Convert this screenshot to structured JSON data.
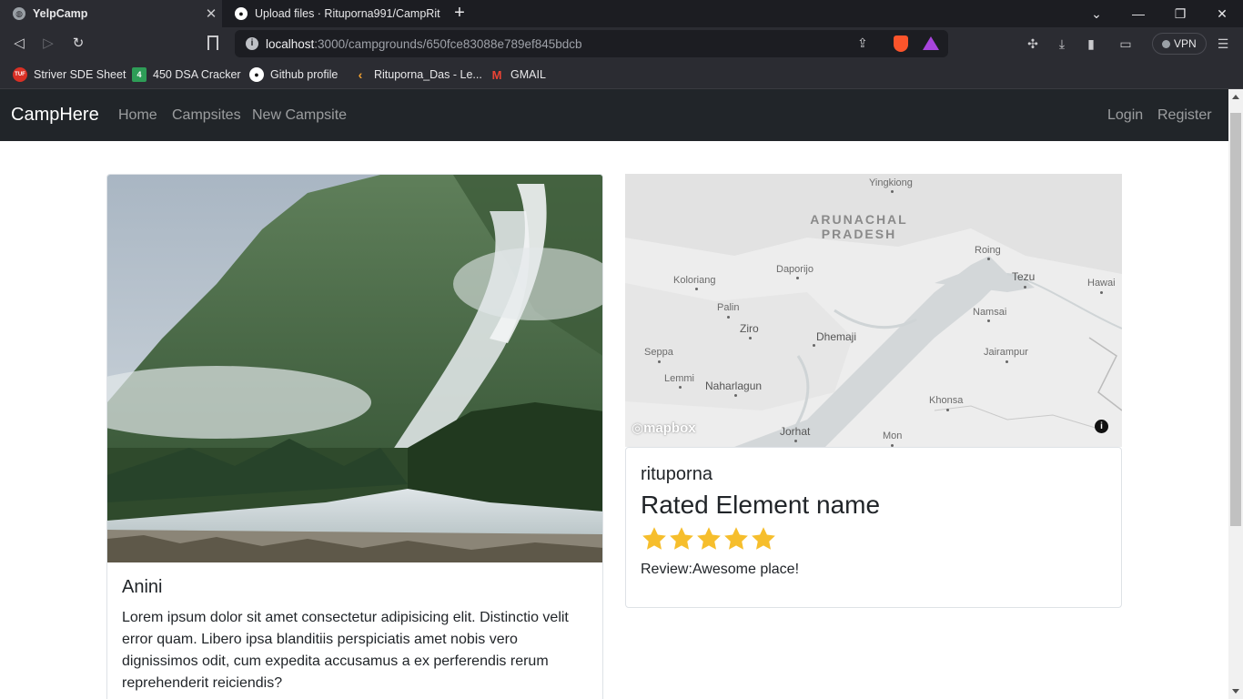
{
  "browser": {
    "tabs": [
      {
        "title": "YelpCamp",
        "active": true
      },
      {
        "title": "Upload files · Rituporna991/CampRitu",
        "active": false
      }
    ],
    "url_host": "localhost",
    "url_path": ":3000/campgrounds/650fce83088e789ef845bdcb",
    "vpn_label": "VPN",
    "bookmarks": [
      {
        "label": "Striver SDE Sheet",
        "icon": "tuf-icon"
      },
      {
        "label": "450 DSA Cracker",
        "icon": "number-4-icon"
      },
      {
        "label": "Github profile",
        "icon": "github-icon"
      },
      {
        "label": "Rituporna_Das - Le...",
        "icon": "leetcode-icon"
      },
      {
        "label": "GMAIL",
        "icon": "gmail-icon"
      }
    ]
  },
  "navbar": {
    "brand": "CampHere",
    "links": [
      "Home",
      "Campsites",
      "New Campsite"
    ],
    "right_links": [
      "Login",
      "Register"
    ]
  },
  "campground": {
    "title": "Anini",
    "description": "Lorem ipsum dolor sit amet consectetur adipisicing elit. Distinctio velit error quam. Libero ipsa blanditiis perspiciatis amet nobis vero dignissimos odit, cum expedita accusamus a ex perferendis rerum reprehenderit reiciendis?"
  },
  "map": {
    "region": "ARUNACHAL\nPRADESH",
    "places": [
      "Yingkiong",
      "Roing",
      "Tezu",
      "Hawai",
      "Koloriang",
      "Daporijo",
      "Palin",
      "Ziro",
      "Namsai",
      "Dhemaji",
      "Seppa",
      "Jairampur",
      "Lemmi",
      "Naharlagun",
      "Khonsa",
      "Jorhat",
      "Mon"
    ],
    "attribution": "mapbox"
  },
  "review": {
    "author": "rituporna",
    "heading": "Rated Element name",
    "rating": 5,
    "max_rating": 5,
    "text": "Review:Awesome place!",
    "star_color": "#f6be2c"
  }
}
